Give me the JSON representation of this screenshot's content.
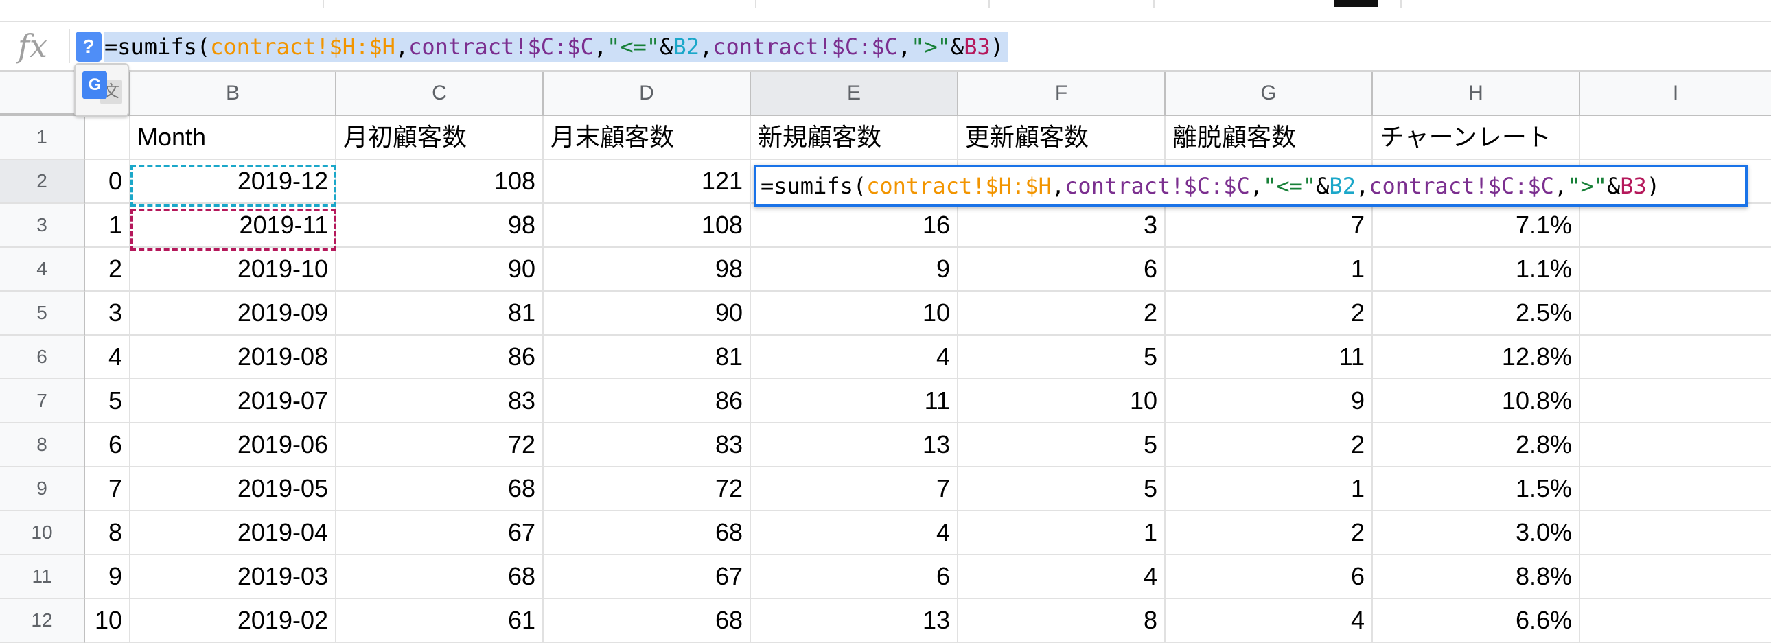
{
  "formula_bar": {
    "fx_label": "fx",
    "help_badge": "?",
    "formula_parts": [
      {
        "text": "=sumifs(",
        "color": "#000000"
      },
      {
        "text": "contract!$H:$H",
        "color": "#f29500"
      },
      {
        "text": ",",
        "color": "#000000"
      },
      {
        "text": "contract!$C:$C",
        "color": "#7b2f8f"
      },
      {
        "text": ",",
        "color": "#000000"
      },
      {
        "text": "\"<=\"",
        "color": "#188038"
      },
      {
        "text": "&",
        "color": "#000000"
      },
      {
        "text": "B2",
        "color": "#1ba7c9"
      },
      {
        "text": ",",
        "color": "#000000"
      },
      {
        "text": "contract!$C:$C",
        "color": "#7b2f8f"
      },
      {
        "text": ",",
        "color": "#000000"
      },
      {
        "text": "\">\"",
        "color": "#188038"
      },
      {
        "text": "&",
        "color": "#000000"
      },
      {
        "text": "B3",
        "color": "#b5185b"
      },
      {
        "text": ")",
        "color": "#000000"
      }
    ]
  },
  "translate_icon": {
    "g": "G",
    "k": "文"
  },
  "columns": [
    "",
    "B",
    "C",
    "D",
    "E",
    "F",
    "G",
    "H",
    "I"
  ],
  "header_row": [
    "1",
    "",
    "Month",
    "月初顧客数",
    "月末顧客数",
    "新規顧客数",
    "更新顧客数",
    "離脱顧客数",
    "チャーンレート",
    ""
  ],
  "rows": [
    [
      "2",
      "0",
      "2019-12",
      "108",
      "121",
      "",
      "",
      "",
      "",
      ""
    ],
    [
      "3",
      "1",
      "2019-11",
      "98",
      "108",
      "16",
      "3",
      "7",
      "7.1%",
      ""
    ],
    [
      "4",
      "2",
      "2019-10",
      "90",
      "98",
      "9",
      "6",
      "1",
      "1.1%",
      ""
    ],
    [
      "5",
      "3",
      "2019-09",
      "81",
      "90",
      "10",
      "2",
      "2",
      "2.5%",
      ""
    ],
    [
      "6",
      "4",
      "2019-08",
      "86",
      "81",
      "4",
      "5",
      "11",
      "12.8%",
      ""
    ],
    [
      "7",
      "5",
      "2019-07",
      "83",
      "86",
      "11",
      "10",
      "9",
      "10.8%",
      ""
    ],
    [
      "8",
      "6",
      "2019-06",
      "72",
      "83",
      "13",
      "5",
      "2",
      "2.8%",
      ""
    ],
    [
      "9",
      "7",
      "2019-05",
      "68",
      "72",
      "7",
      "5",
      "1",
      "1.5%",
      ""
    ],
    [
      "10",
      "8",
      "2019-04",
      "67",
      "68",
      "4",
      "1",
      "2",
      "3.0%",
      ""
    ],
    [
      "11",
      "9",
      "2019-03",
      "68",
      "67",
      "6",
      "4",
      "6",
      "8.8%",
      ""
    ],
    [
      "12",
      "10",
      "2019-02",
      "61",
      "68",
      "13",
      "8",
      "4",
      "6.6%",
      ""
    ]
  ]
}
